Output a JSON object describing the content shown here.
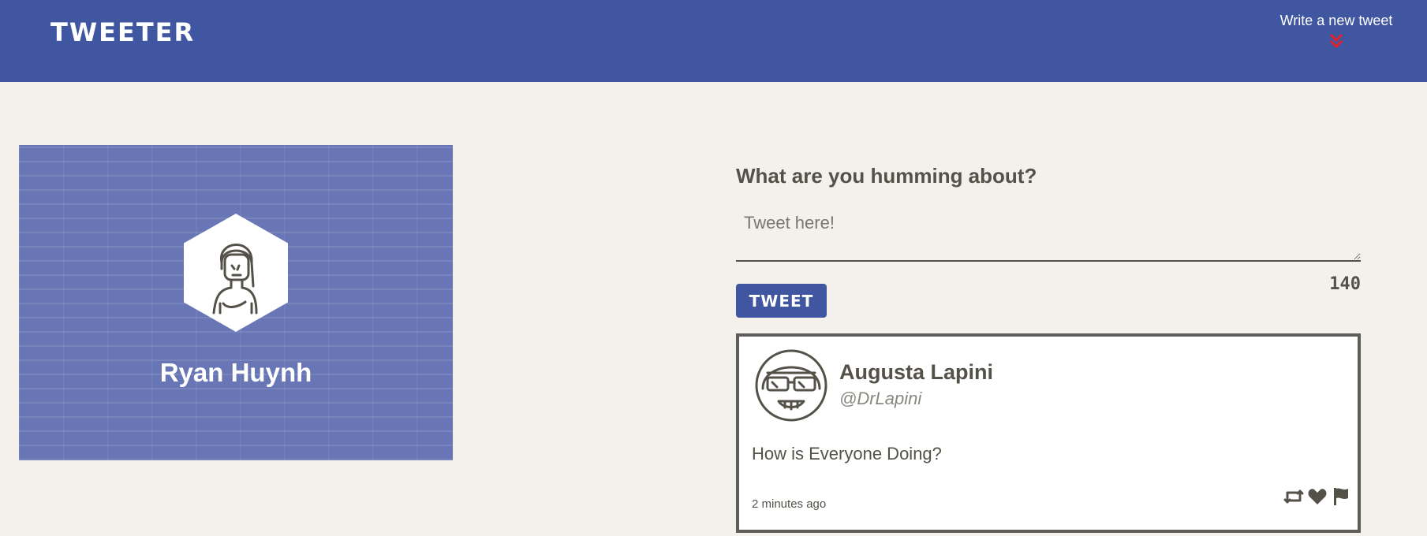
{
  "nav": {
    "logo": "TWEETER",
    "compose_label": "Write a new tweet",
    "compose_icon": "double-chevron-down-icon",
    "accent_color": "#e8202a"
  },
  "profile": {
    "name": "Ryan Huynh",
    "avatar_icon": "user-avatar-icon",
    "background_color": "#6876b5"
  },
  "composer": {
    "heading": "What are you humming about?",
    "placeholder": "Tweet here!",
    "value": "",
    "button_label": "TWEET",
    "char_count": "140"
  },
  "tweets": [
    {
      "author": "Augusta Lapini",
      "handle": "@DrLapini",
      "text": "How is Everyone Doing?",
      "time": "2 minutes ago",
      "avatar_icon": "user-avatar-sunglasses-icon",
      "actions": [
        "retweet-icon",
        "heart-icon",
        "flag-icon"
      ]
    }
  ],
  "colors": {
    "nav": "#4056a1",
    "page_bg": "#f4f1ec",
    "text": "#545149"
  }
}
